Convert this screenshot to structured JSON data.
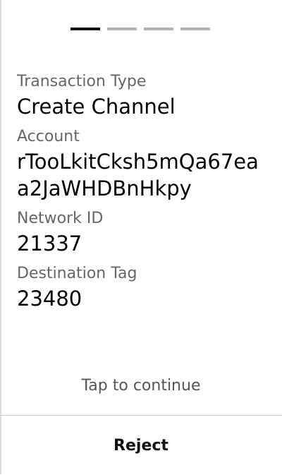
{
  "pager": {
    "pages": [
      {
        "active": true
      },
      {
        "active": false
      },
      {
        "active": false
      },
      {
        "active": false
      }
    ]
  },
  "fields": [
    {
      "label": "Transaction Type",
      "value": "Create Channel"
    },
    {
      "label": "Account",
      "value": "rTooLkitCksh5mQa67eaa2JaWHDBnHkpy"
    },
    {
      "label": "Network ID",
      "value": "21337"
    },
    {
      "label": "Destination Tag",
      "value": "23480"
    }
  ],
  "hint": "Tap to continue",
  "footer": {
    "reject_label": "Reject"
  }
}
